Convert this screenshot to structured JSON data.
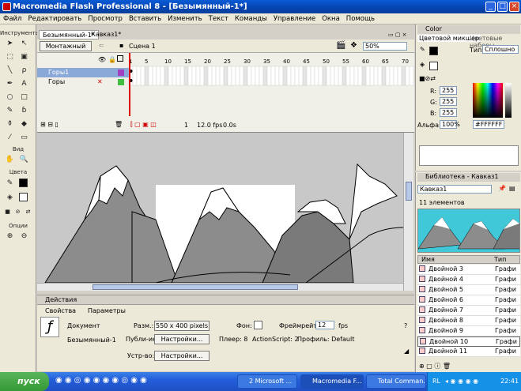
{
  "window": {
    "title": "Macromedia Flash Professional 8 - [Безымянный-1*]",
    "min": "_",
    "max": "□",
    "close": "×"
  },
  "menu": [
    "Файл",
    "Редактировать",
    "Просмотр",
    "Вставить",
    "Изменить",
    "Текст",
    "Команды",
    "Управление",
    "Окна",
    "Помощь"
  ],
  "toolbox": {
    "title": "Инструменты",
    "view": "Вид",
    "colors": "Цвета",
    "options": "Опции"
  },
  "doc": {
    "tab_active": "Безымянный-1*",
    "tab_other": "Кавказ1*",
    "workspace_btn": "Монтажный стол",
    "scene": "Сцена 1",
    "zoom": "50%"
  },
  "timeline": {
    "frame_numbers": [
      "1",
      "5",
      "10",
      "15",
      "20",
      "25",
      "30",
      "35",
      "40",
      "45",
      "50",
      "55",
      "60",
      "65",
      "70"
    ],
    "layers": [
      {
        "name": "Горы1"
      },
      {
        "name": "Горы"
      }
    ],
    "current_frame": "1",
    "fps": "12.0 fps",
    "time": "0.0s"
  },
  "panels": {
    "actions": "Действия",
    "properties_tab": "Свойства",
    "params_tab": "Параметры"
  },
  "props": {
    "doc_label": "Документ",
    "doc_name": "Безымянный-1",
    "size_label": "Разм.:",
    "size_value": "550 x 400 pixels",
    "bg_label": "Фон:",
    "fps_label": "Фреймрейт:",
    "fps_value": "12",
    "fps_unit": "fps",
    "publish_label": "Публи-ие:",
    "settings_btn": "Настройки...",
    "player": "Плеер: 8",
    "actionscript": "ActionScript: 2",
    "profile": "Профиль: Default",
    "device_label": "Устр-во:",
    "device_btn": "Настройки..."
  },
  "color": {
    "title": "Color",
    "tab_mixer": "Цветовой микшер",
    "tab_swatches": "Цветовые наборы",
    "type_label": "Тип:",
    "type_value": "Сплошно",
    "r_label": "R:",
    "r": "255",
    "g_label": "G:",
    "g": "255",
    "b_label": "B:",
    "b": "255",
    "alpha_label": "Альфа:",
    "alpha": "100%",
    "hex": "#FFFFFF"
  },
  "library": {
    "title": "Библиотека - Кавказ1",
    "source": "Кавказ1",
    "count": "11 элементов",
    "col_name": "Имя",
    "col_type": "Тип",
    "items": [
      {
        "name": "Двойной 3",
        "type": "Графи"
      },
      {
        "name": "Двойной 4",
        "type": "Графи"
      },
      {
        "name": "Двойной 5",
        "type": "Графи"
      },
      {
        "name": "Двойной 6",
        "type": "Графи"
      },
      {
        "name": "Двойной 7",
        "type": "Графи"
      },
      {
        "name": "Двойной 8",
        "type": "Графи"
      },
      {
        "name": "Двойной 9",
        "type": "Графи"
      },
      {
        "name": "Двойной 10",
        "type": "Графи"
      },
      {
        "name": "Двойной 11",
        "type": "Графи"
      }
    ]
  },
  "taskbar": {
    "start": "пуск",
    "tasks": [
      "2 Microsoft ...",
      "Macromedia F...",
      "Total Comman..."
    ],
    "lang": "RL",
    "time": "22:41"
  },
  "colors": {
    "title_blue": "#0544b0",
    "taskbar": "#245edb",
    "stage_gray": "#c8c8c8",
    "mountain": "#8c8c8c",
    "snow": "#ffffff",
    "preview_bg": "#40c8d8"
  }
}
